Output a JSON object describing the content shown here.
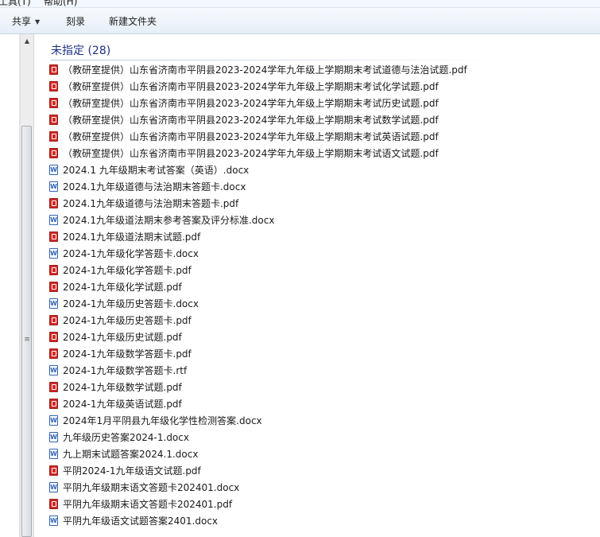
{
  "menubar": {
    "tools_label": "工具(T)",
    "help_label": "帮助(H)"
  },
  "toolbar": {
    "share_label": "共享",
    "burn_label": "刻录",
    "new_folder_label": "新建文件夹"
  },
  "group": {
    "header": "未指定 (28)"
  },
  "files": [
    {
      "name": "（教研室提供）山东省济南市平阴县2023-2024学年九年级上学期期末考试道德与法治试题.pdf",
      "icon": "pdf-file-icon"
    },
    {
      "name": "（教研室提供）山东省济南市平阴县2023-2024学年九年级上学期期末考试化学试题.pdf",
      "icon": "pdf-file-icon"
    },
    {
      "name": "（教研室提供）山东省济南市平阴县2023-2024学年九年级上学期期末考试历史试题.pdf",
      "icon": "pdf-file-icon"
    },
    {
      "name": "（教研室提供）山东省济南市平阴县2023-2024学年九年级上学期期末考试数学试题.pdf",
      "icon": "pdf-file-icon"
    },
    {
      "name": "（教研室提供）山东省济南市平阴县2023-2024学年九年级上学期期末考试英语试题.pdf",
      "icon": "pdf-file-icon"
    },
    {
      "name": "（教研室提供）山东省济南市平阴县2023-2024学年九年级上学期期末考试语文试题.pdf",
      "icon": "pdf-file-icon"
    },
    {
      "name": "2024.1 九年级期末考试答案（英语）.docx",
      "icon": "word-file-icon"
    },
    {
      "name": "2024.1九年级道德与法治期末答题卡.docx",
      "icon": "word-file-icon"
    },
    {
      "name": "2024.1九年级道德与法治期末答题卡.pdf",
      "icon": "pdf-file-icon"
    },
    {
      "name": "2024.1九年级道法期末参考答案及评分标准.docx",
      "icon": "word-file-icon"
    },
    {
      "name": "2024.1九年级道法期末试题.pdf",
      "icon": "pdf-file-icon"
    },
    {
      "name": "2024-1九年级化学答题卡.docx",
      "icon": "word-file-icon"
    },
    {
      "name": "2024-1九年级化学答题卡.pdf",
      "icon": "pdf-file-icon"
    },
    {
      "name": "2024-1九年级化学试题.pdf",
      "icon": "pdf-file-icon"
    },
    {
      "name": "2024-1九年级历史答题卡.docx",
      "icon": "word-file-icon"
    },
    {
      "name": "2024-1九年级历史答题卡.pdf",
      "icon": "pdf-file-icon"
    },
    {
      "name": "2024-1九年级历史试题.pdf",
      "icon": "pdf-file-icon"
    },
    {
      "name": "2024-1九年级数学答题卡.pdf",
      "icon": "pdf-file-icon"
    },
    {
      "name": "2024-1九年级数学答题卡.rtf",
      "icon": "word-file-icon"
    },
    {
      "name": "2024-1九年级数学试题.pdf",
      "icon": "pdf-file-icon"
    },
    {
      "name": "2024-1九年级英语试题.pdf",
      "icon": "pdf-file-icon"
    },
    {
      "name": "2024年1月平阴县九年级化学性检测答案.docx",
      "icon": "word-file-icon"
    },
    {
      "name": "九年级历史答案2024-1.docx",
      "icon": "word-file-icon"
    },
    {
      "name": "九上期末试题答案2024.1.docx",
      "icon": "word-file-icon"
    },
    {
      "name": "平阴2024-1九年级语文试题.pdf",
      "icon": "pdf-file-icon"
    },
    {
      "name": "平阴九年级期末语文答题卡202401.docx",
      "icon": "word-file-icon"
    },
    {
      "name": "平阴九年级期末语文答题卡202401.pdf",
      "icon": "pdf-file-icon"
    },
    {
      "name": "平阴九年级语文试题答案2401.docx",
      "icon": "word-file-icon"
    }
  ]
}
